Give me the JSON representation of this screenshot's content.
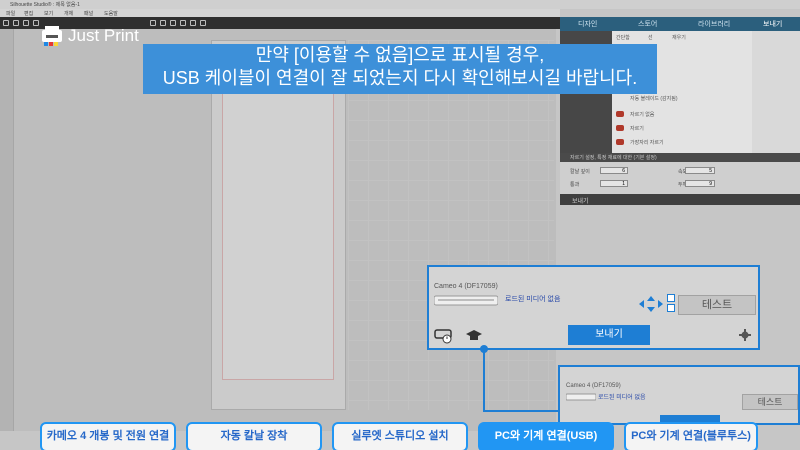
{
  "window": {
    "title": "Silhouette Studio® : 제목 없음-1",
    "menu": [
      "파일",
      "편집",
      "보기",
      "개체",
      "패널",
      "도움말"
    ]
  },
  "logo": {
    "text": "Just Print"
  },
  "subtitle": {
    "line1": "만약 [이용할 수 없음]으로 표시될 경우,",
    "line2": "USB 케이블이 연결이 잘 되었는지 다시 확인해보시길 바랍니다."
  },
  "right_panel": {
    "tabs": [
      "디자인",
      "스토어",
      "라이브러리",
      "보내기"
    ],
    "options": [
      "간단함",
      "선",
      "재우기",
      "자동 블레이드 (감지됨)",
      "자르기 없음",
      "자르기",
      "가장자리 자르기"
    ],
    "param_header": "자르기 설정, 특정 재료에 대한 (기본 설정)",
    "params": [
      {
        "label": "칼날 깊이",
        "value": "6"
      },
      {
        "label": "속도",
        "value": "5"
      },
      {
        "label": "통과",
        "value": "1"
      },
      {
        "label": "두께",
        "value": "9"
      }
    ],
    "send_section": "보내기"
  },
  "send_panel_main": {
    "device": "Cameo 4 (DF17059)",
    "media_status": "로드된 미디어 없음",
    "test_label": "테스트",
    "send_label": "보내기"
  },
  "send_panel_small": {
    "device": "Cameo 4 (DF17059)",
    "media_status": "로드된 미디어 없음",
    "test_label": "테스트"
  },
  "bottom_nav": [
    {
      "label": "카메오 4 개봉 및 전원 연결",
      "active": false
    },
    {
      "label": "자동 칼날 장착",
      "active": false
    },
    {
      "label": "실루엣 스튜디오 설치",
      "active": false
    },
    {
      "label": "PC와 기계 연결(USB)",
      "active": true
    },
    {
      "label": "PC와 기계 연결(블루투스)",
      "active": false
    }
  ],
  "colors": {
    "accent": "#1e7ed4",
    "subtitle_bg": "#3d90d9",
    "nav_border": "#2196f3"
  }
}
